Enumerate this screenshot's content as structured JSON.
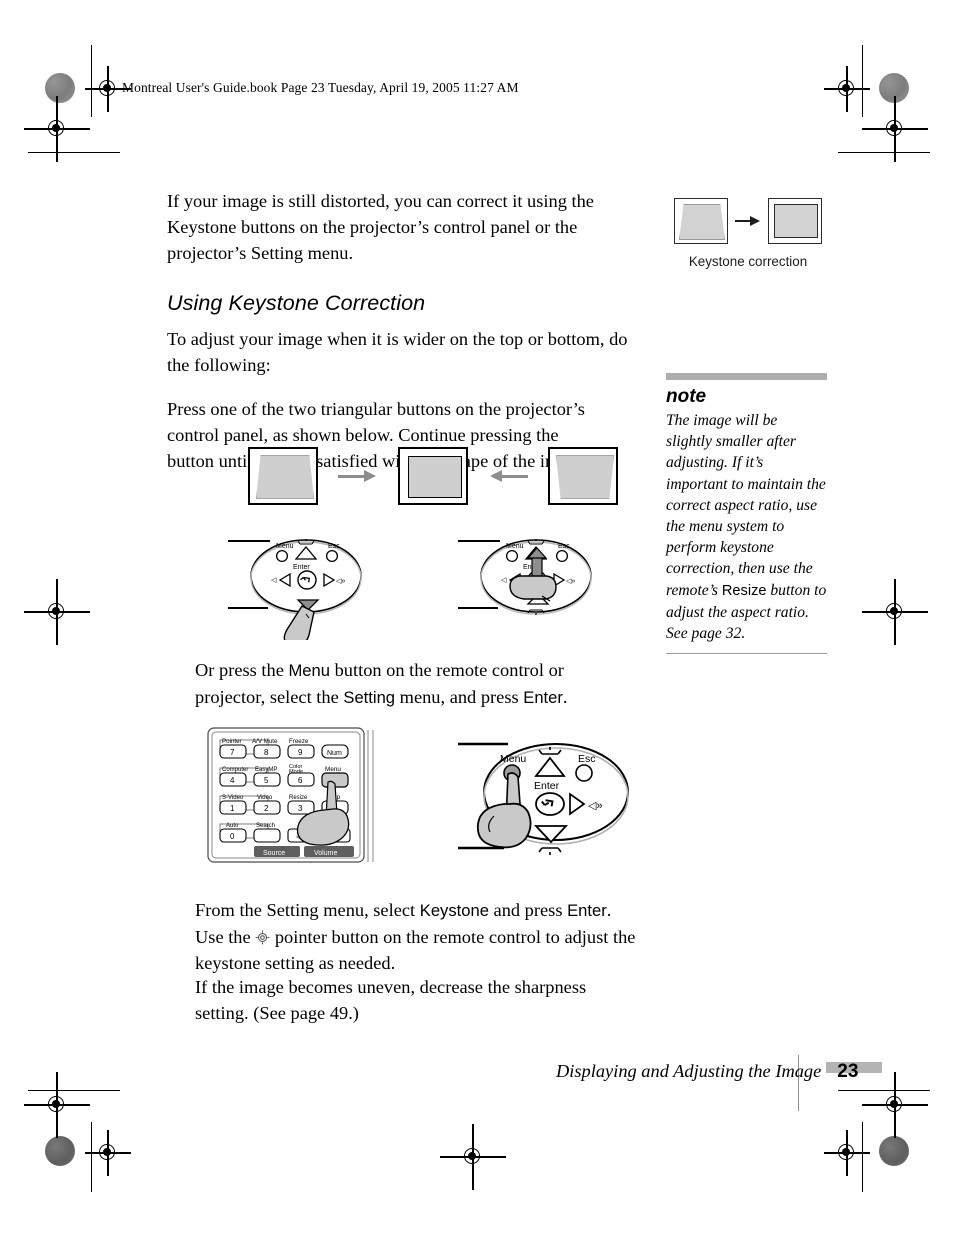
{
  "header": {
    "text": "Montreal User's Guide.book  Page 23  Tuesday, April 19, 2005  11:27 AM"
  },
  "main": {
    "intro_paragraph": "If your image is still distorted, you can correct it using the Keystone buttons on the projector’s control panel or the projector’s Setting menu.",
    "section_heading": "Using Keystone Correction",
    "lead_paragraph": "To adjust your image when it is wider on the top or bottom, do the following:",
    "step1": "Press one of the two triangular buttons on the projector’s control panel, as shown below. Continue pressing the button until you are satisfied with the shape of the image.",
    "step2": {
      "part1": "Or press the ",
      "ui1": "Menu",
      "part2": " button on the remote control or projector, select the ",
      "ui2": "Setting",
      "part3": " menu, and press ",
      "ui3": "Enter",
      "part4": "."
    },
    "step3": {
      "part1": "From the Setting menu, select ",
      "ui1": "Keystone",
      "part2": " and press ",
      "ui2": "Enter",
      "part3": ". Use the ",
      "part4": " pointer button on the remote control to adjust the keystone setting as needed."
    },
    "step4": "If the image becomes uneven, decrease the sharpness setting. (See page 49.)"
  },
  "keystone_figure": {
    "caption": "Keystone correction",
    "arrow_icon": "arrow-right-icon"
  },
  "note": {
    "title": "note",
    "body": {
      "part1": "The image will be slightly smaller after adjusting. If it’s important to maintain the correct aspect ratio, use the menu system to perform keystone correction, then use the remote’s ",
      "ui1": "Resize",
      "part2": " button to adjust the aspect ratio. See page 32."
    }
  },
  "control_panel": {
    "labels": {
      "menu": "Menu",
      "esc": "Esc",
      "enter": "Enter"
    }
  },
  "remote": {
    "buttons": [
      {
        "name": "Pointer",
        "number": "7"
      },
      {
        "name": "A/V Mute",
        "number": "8"
      },
      {
        "name": "Freeze",
        "number": "9"
      },
      {
        "name": "Num",
        "number": ""
      },
      {
        "name": "Computer",
        "number": "4"
      },
      {
        "name": "EasyMP",
        "number": "5"
      },
      {
        "name": "Color Mode",
        "number": "6"
      },
      {
        "name": "Menu",
        "number": ""
      },
      {
        "name": "S-Video",
        "number": "1"
      },
      {
        "name": "Video",
        "number": "2"
      },
      {
        "name": "Resize",
        "number": "3"
      },
      {
        "name": "Help",
        "number": ""
      },
      {
        "name": "Auto",
        "number": "0"
      },
      {
        "name": "Search",
        "number": ""
      }
    ],
    "bars": {
      "source": "Source",
      "volume": "Volume"
    }
  },
  "footer": {
    "title": "Displaying and Adjusting the Image",
    "page_number": "23"
  },
  "colors": {
    "note_rule": "#aeaeae",
    "figure_fill": "#cfcfcf",
    "hand_fill": "#c9c9c9",
    "footer_bar": "#b4b4b4"
  }
}
